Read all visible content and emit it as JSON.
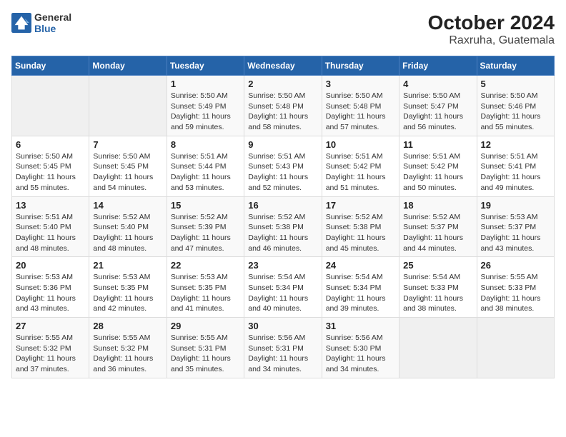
{
  "header": {
    "logo_line1": "General",
    "logo_line2": "Blue",
    "title": "October 2024",
    "subtitle": "Raxruha, Guatemala"
  },
  "weekdays": [
    "Sunday",
    "Monday",
    "Tuesday",
    "Wednesday",
    "Thursday",
    "Friday",
    "Saturday"
  ],
  "weeks": [
    [
      {
        "day": "",
        "info": ""
      },
      {
        "day": "",
        "info": ""
      },
      {
        "day": "1",
        "info": "Sunrise: 5:50 AM\nSunset: 5:49 PM\nDaylight: 11 hours and 59 minutes."
      },
      {
        "day": "2",
        "info": "Sunrise: 5:50 AM\nSunset: 5:48 PM\nDaylight: 11 hours and 58 minutes."
      },
      {
        "day": "3",
        "info": "Sunrise: 5:50 AM\nSunset: 5:48 PM\nDaylight: 11 hours and 57 minutes."
      },
      {
        "day": "4",
        "info": "Sunrise: 5:50 AM\nSunset: 5:47 PM\nDaylight: 11 hours and 56 minutes."
      },
      {
        "day": "5",
        "info": "Sunrise: 5:50 AM\nSunset: 5:46 PM\nDaylight: 11 hours and 55 minutes."
      }
    ],
    [
      {
        "day": "6",
        "info": "Sunrise: 5:50 AM\nSunset: 5:45 PM\nDaylight: 11 hours and 55 minutes."
      },
      {
        "day": "7",
        "info": "Sunrise: 5:50 AM\nSunset: 5:45 PM\nDaylight: 11 hours and 54 minutes."
      },
      {
        "day": "8",
        "info": "Sunrise: 5:51 AM\nSunset: 5:44 PM\nDaylight: 11 hours and 53 minutes."
      },
      {
        "day": "9",
        "info": "Sunrise: 5:51 AM\nSunset: 5:43 PM\nDaylight: 11 hours and 52 minutes."
      },
      {
        "day": "10",
        "info": "Sunrise: 5:51 AM\nSunset: 5:42 PM\nDaylight: 11 hours and 51 minutes."
      },
      {
        "day": "11",
        "info": "Sunrise: 5:51 AM\nSunset: 5:42 PM\nDaylight: 11 hours and 50 minutes."
      },
      {
        "day": "12",
        "info": "Sunrise: 5:51 AM\nSunset: 5:41 PM\nDaylight: 11 hours and 49 minutes."
      }
    ],
    [
      {
        "day": "13",
        "info": "Sunrise: 5:51 AM\nSunset: 5:40 PM\nDaylight: 11 hours and 48 minutes."
      },
      {
        "day": "14",
        "info": "Sunrise: 5:52 AM\nSunset: 5:40 PM\nDaylight: 11 hours and 48 minutes."
      },
      {
        "day": "15",
        "info": "Sunrise: 5:52 AM\nSunset: 5:39 PM\nDaylight: 11 hours and 47 minutes."
      },
      {
        "day": "16",
        "info": "Sunrise: 5:52 AM\nSunset: 5:38 PM\nDaylight: 11 hours and 46 minutes."
      },
      {
        "day": "17",
        "info": "Sunrise: 5:52 AM\nSunset: 5:38 PM\nDaylight: 11 hours and 45 minutes."
      },
      {
        "day": "18",
        "info": "Sunrise: 5:52 AM\nSunset: 5:37 PM\nDaylight: 11 hours and 44 minutes."
      },
      {
        "day": "19",
        "info": "Sunrise: 5:53 AM\nSunset: 5:37 PM\nDaylight: 11 hours and 43 minutes."
      }
    ],
    [
      {
        "day": "20",
        "info": "Sunrise: 5:53 AM\nSunset: 5:36 PM\nDaylight: 11 hours and 43 minutes."
      },
      {
        "day": "21",
        "info": "Sunrise: 5:53 AM\nSunset: 5:35 PM\nDaylight: 11 hours and 42 minutes."
      },
      {
        "day": "22",
        "info": "Sunrise: 5:53 AM\nSunset: 5:35 PM\nDaylight: 11 hours and 41 minutes."
      },
      {
        "day": "23",
        "info": "Sunrise: 5:54 AM\nSunset: 5:34 PM\nDaylight: 11 hours and 40 minutes."
      },
      {
        "day": "24",
        "info": "Sunrise: 5:54 AM\nSunset: 5:34 PM\nDaylight: 11 hours and 39 minutes."
      },
      {
        "day": "25",
        "info": "Sunrise: 5:54 AM\nSunset: 5:33 PM\nDaylight: 11 hours and 38 minutes."
      },
      {
        "day": "26",
        "info": "Sunrise: 5:55 AM\nSunset: 5:33 PM\nDaylight: 11 hours and 38 minutes."
      }
    ],
    [
      {
        "day": "27",
        "info": "Sunrise: 5:55 AM\nSunset: 5:32 PM\nDaylight: 11 hours and 37 minutes."
      },
      {
        "day": "28",
        "info": "Sunrise: 5:55 AM\nSunset: 5:32 PM\nDaylight: 11 hours and 36 minutes."
      },
      {
        "day": "29",
        "info": "Sunrise: 5:55 AM\nSunset: 5:31 PM\nDaylight: 11 hours and 35 minutes."
      },
      {
        "day": "30",
        "info": "Sunrise: 5:56 AM\nSunset: 5:31 PM\nDaylight: 11 hours and 34 minutes."
      },
      {
        "day": "31",
        "info": "Sunrise: 5:56 AM\nSunset: 5:30 PM\nDaylight: 11 hours and 34 minutes."
      },
      {
        "day": "",
        "info": ""
      },
      {
        "day": "",
        "info": ""
      }
    ]
  ]
}
